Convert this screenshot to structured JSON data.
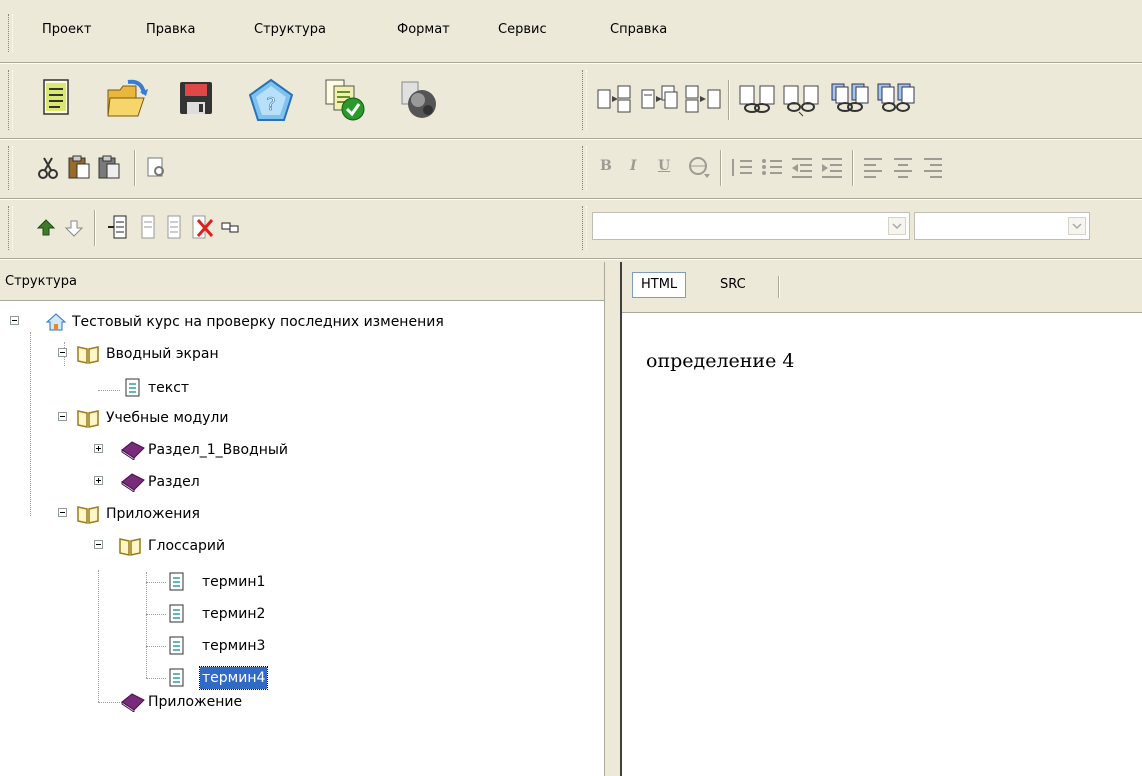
{
  "menu": [
    "Проект",
    "Правка",
    "Структура",
    "Формат",
    "Сервис",
    "Справка"
  ],
  "toolbar": {
    "file_icons": [
      "new-document-icon",
      "open-folder-icon",
      "save-disk-icon",
      "help-pentagon-icon",
      "validate-copy-icon",
      "publish-globe-icon"
    ],
    "page_icons": [
      "page-insert-before-icon",
      "page-insert-after-icon",
      "page-move-icon",
      "link-icon",
      "unlink-icon",
      "link-multiple-icon",
      "unlink-multiple-icon"
    ],
    "edit_icons": [
      "cut-icon",
      "paste-icon",
      "paste-special-icon",
      "find-icon"
    ],
    "format_buttons": [
      "B",
      "I",
      "U"
    ],
    "tree_icons": [
      "move-up-icon",
      "move-down-icon",
      "add-child-icon",
      "add-sibling-icon",
      "add-after-icon",
      "delete-node-icon",
      "rename-icon"
    ],
    "font_combo": "",
    "size_combo": ""
  },
  "tree": {
    "header": "Структура",
    "nodes": [
      {
        "label": "Тестовый курс на проверку последних изменения",
        "icon": "home-icon"
      },
      {
        "label": "Вводный экран",
        "icon": "open-book-icon"
      },
      {
        "label": "текст",
        "icon": "document-icon"
      },
      {
        "label": "Учебные модули",
        "icon": "open-book-icon"
      },
      {
        "label": "Раздел_1_Вводный",
        "icon": "closed-book-icon"
      },
      {
        "label": "Раздел",
        "icon": "closed-book-icon"
      },
      {
        "label": "Приложения",
        "icon": "open-book-icon"
      },
      {
        "label": "Глоссарий",
        "icon": "open-book-icon"
      },
      {
        "label": "термин1",
        "icon": "document-icon"
      },
      {
        "label": "термин2",
        "icon": "document-icon"
      },
      {
        "label": "термин3",
        "icon": "document-icon"
      },
      {
        "label": "термин4",
        "icon": "document-icon",
        "selected": true
      },
      {
        "label": "Приложение",
        "icon": "closed-book-icon"
      }
    ]
  },
  "editor": {
    "tabs": [
      "HTML",
      "SRC"
    ],
    "active_tab": "HTML",
    "content": "определение 4"
  }
}
